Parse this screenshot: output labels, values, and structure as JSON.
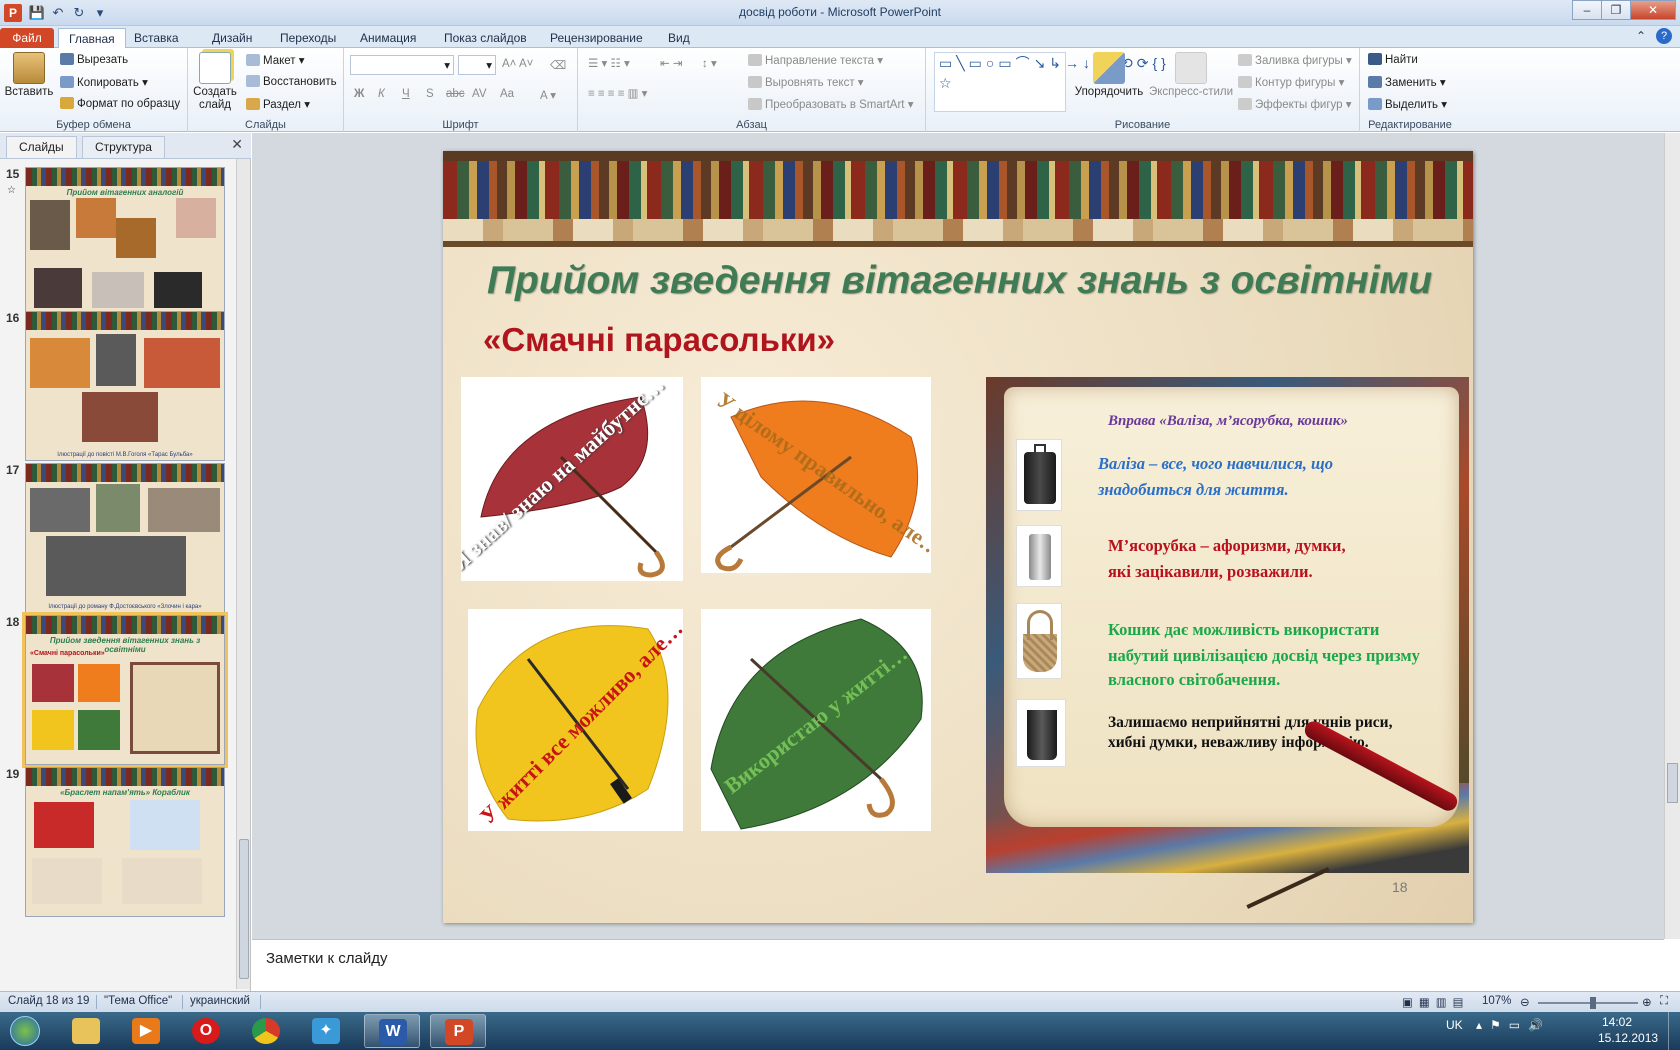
{
  "window": {
    "title": "досвід роботи  -  Microsoft PowerPoint",
    "app_logo": "P",
    "controls": [
      "–",
      "❐",
      "✕"
    ]
  },
  "tabs": [
    "Файл",
    "Главная",
    "Вставка",
    "Дизайн",
    "Переходы",
    "Анимация",
    "Показ слайдов",
    "Рецензирование",
    "Вид"
  ],
  "ribbon": {
    "clipboard": {
      "paste": "Вставить",
      "cut": "Вырезать",
      "copy": "Копировать",
      "format": "Формат по образцу",
      "label": "Буфер обмена"
    },
    "slides": {
      "new": "Создать слайд",
      "layout": "Макет",
      "reset": "Восстановить",
      "section": "Раздел",
      "label": "Слайды"
    },
    "font": {
      "label": "Шрифт",
      "bold": "Ж",
      "italic": "К",
      "underline": "Ч",
      "strike": "abc",
      "shadow": "S",
      "spacing": "AV",
      "case": "Aa"
    },
    "paragraph": {
      "direction": "Направление текста",
      "align": "Выровнять текст",
      "smartart": "Преобразовать в SmartArt",
      "label": "Абзац"
    },
    "drawing": {
      "arrange": "Упорядочить",
      "styles": "Экспресс-стили",
      "fill": "Заливка фигуры",
      "outline": "Контур фигуры",
      "effects": "Эффекты фигур",
      "label": "Рисование"
    },
    "editing": {
      "find": "Найти",
      "replace": "Заменить",
      "select": "Выделить",
      "label": "Редактирование"
    }
  },
  "panel": {
    "tab_slides": "Слайды",
    "tab_outline": "Структура",
    "close": "✕",
    "thumbs": [
      {
        "num": "15",
        "title": "Прийом вітагенних аналогій",
        "caption": ""
      },
      {
        "num": "16",
        "title": "",
        "caption": "Ілюстрації до повісті М.В.Гоголя «Тарас Бульба»"
      },
      {
        "num": "17",
        "title": "",
        "caption": "Ілюстрації до роману Ф.Достоєвського «Злочин і кара»"
      },
      {
        "num": "18",
        "title": "Прийом зведення вітагенних знань з освітніми",
        "caption": "«Смачні парасольки»"
      },
      {
        "num": "19",
        "title": "«Браслет напам'ять»   Кораблик",
        "caption": ""
      }
    ]
  },
  "slide": {
    "title": "Прийом зведення вітагенних знань з освітніми",
    "subtitle": "«Смачні парасольки»",
    "umbrellas": [
      {
        "text": "Я знав/ знаю на майбутнє…",
        "color": "#a8323a"
      },
      {
        "text": "У цілому правильно, але…",
        "color": "#ef7d1e"
      },
      {
        "text": "У житті все можливо, але…",
        "color": "#f2c51e"
      },
      {
        "text": "Використаю у житті…",
        "color": "#3f7a3a"
      }
    ],
    "panel": {
      "heading": "Вправа «Валіза, м’ясорубка, кошик»",
      "suitcase_l1": "Валіза – все, чого навчилися, що",
      "suitcase_l2": "знадобиться для життя.",
      "grinder_l1": "М’ясорубка – афоризми, думки,",
      "grinder_l2": "які зацікавили, розважили.",
      "basket_l1": "Кошик дає можливість використати",
      "basket_l2": "набутий цивілізацією досвід через призму",
      "basket_l3": "власного світобачення.",
      "bin_l1": "Залишаємо неприйнятні для учнів риси,",
      "bin_l2": "хибні думки, неважливу інформацію."
    },
    "number": "18"
  },
  "notes": {
    "placeholder": "Заметки к слайду"
  },
  "status": {
    "slide": "Слайд 18 из 19",
    "theme": "\"Тема Office\"",
    "lang": "украинский",
    "zoom": "107%",
    "zoom_fraction": 0.55
  },
  "taskbar": {
    "lang": "UK",
    "time": "14:02",
    "date": "15.12.2013"
  },
  "colors": {
    "accent": "#d24726",
    "title_green": "#3f7b55",
    "subtitle_red": "#b0141c"
  }
}
